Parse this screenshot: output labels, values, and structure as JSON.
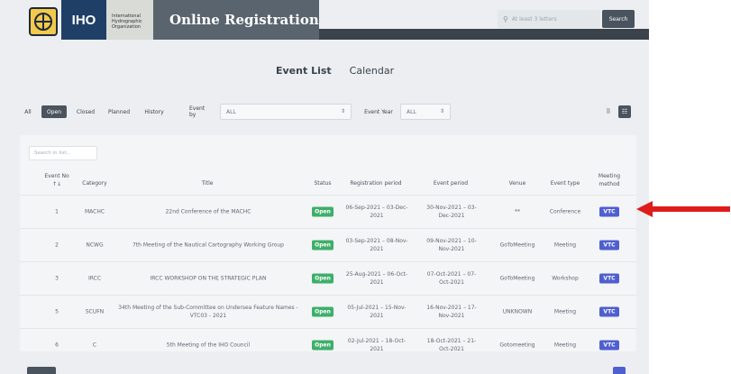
{
  "header": {
    "logo_text": "IHO",
    "org_lines": [
      "International",
      "Hydrographic",
      "Organization"
    ],
    "app_title": "Online Registration",
    "search_placeholder": "At least 3 letters",
    "search_button": "Search"
  },
  "view_tabs": {
    "active": "Event List",
    "other": "Calendar"
  },
  "filters": {
    "buttons": [
      "All",
      "Open",
      "Closed",
      "Planned",
      "History"
    ],
    "active_button": "Open",
    "event_by_label": "Event by",
    "event_by_value": "ALL",
    "event_year_label": "Event Year",
    "event_year_value": "ALL"
  },
  "list_search_placeholder": "Search in list...",
  "table": {
    "headers": {
      "no": "Event No ↑↓",
      "category": "Category",
      "title": "Title",
      "status": "Status",
      "registration": "Registration period",
      "event_period": "Event period",
      "venue": "Venue",
      "event_type": "Event type",
      "meeting_method": "Meeting method"
    },
    "rows": [
      {
        "no": "1",
        "category": "MACHC",
        "title": "22nd Conference of the MACHC",
        "status": "Open",
        "registration": "06-Sep-2021 – 03-Dec-2021",
        "event_period": "30-Nov-2021 – 03-Dec-2021",
        "venue": "**",
        "event_type": "Conference",
        "method": "VTC"
      },
      {
        "no": "2",
        "category": "NCWG",
        "title": "7th Meeting of the Nautical Cartography Working Group",
        "status": "Open",
        "registration": "03-Sep-2021 – 08-Nov-2021",
        "event_period": "09-Nov-2021 – 10-Nov-2021",
        "venue": "GoToMeeting",
        "event_type": "Meeting",
        "method": "VTC"
      },
      {
        "no": "3",
        "category": "IRCC",
        "title": "IRCC WORKSHOP ON THE STRATEGIC PLAN",
        "status": "Open",
        "registration": "25-Aug-2021 – 06-Oct-2021",
        "event_period": "07-Oct-2021 – 07-Oct-2021",
        "venue": "GoToMeeting",
        "event_type": "Workshop",
        "method": "VTC"
      },
      {
        "no": "5",
        "category": "SCUFN",
        "title": "34th Meeting of the Sub-Committee on Undersea Feature Names - VTC03 - 2021",
        "status": "Open",
        "registration": "05-Jul-2021 – 15-Nov-2021",
        "event_period": "16-Nov-2021 – 17-Nov-2021",
        "venue": "UNKNOWN",
        "event_type": "Meeting",
        "method": "VTC"
      },
      {
        "no": "6",
        "category": "C",
        "title": "5th Meeting of the IHO Council",
        "status": "Open",
        "registration": "02-Jul-2021 – 18-Oct-2021",
        "event_period": "18-Oct-2021 – 21-Oct-2021",
        "venue": "Gotomeeting",
        "event_type": "Meeting",
        "method": "VTC"
      }
    ]
  },
  "colors": {
    "open_badge": "#3fae6a",
    "vtc_badge": "#4f5fd0",
    "annotation_arrow": "#e01b1b",
    "header_dark": "#5a646e",
    "logo_blue": "#1f3f66"
  },
  "icons": {
    "search": "magnifier-icon",
    "grid_view": "grid-icon",
    "list_view": "list-icon",
    "annotation": "red-arrow-icon"
  }
}
